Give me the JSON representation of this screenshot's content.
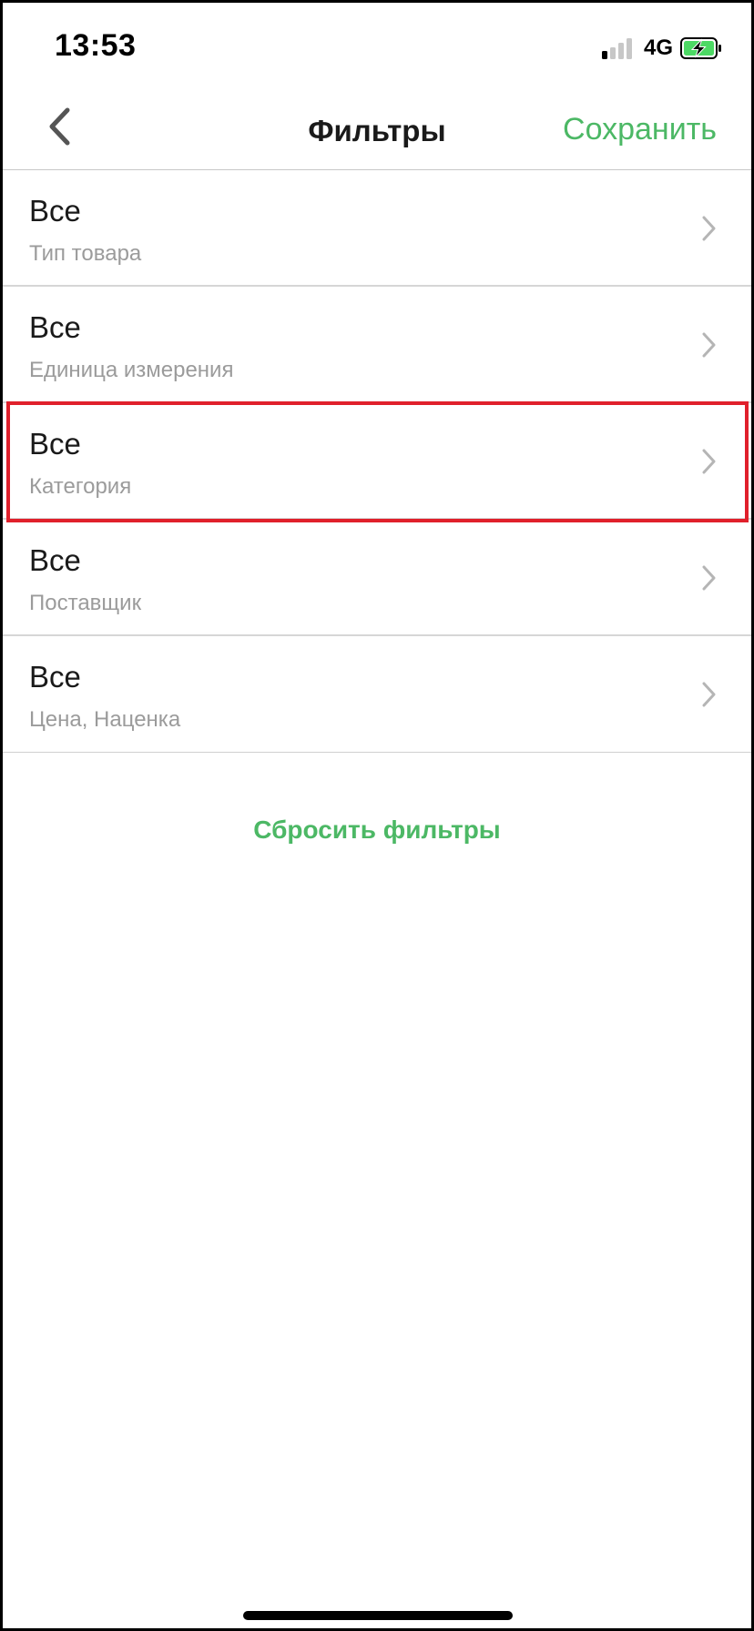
{
  "status_bar": {
    "time": "13:53",
    "network": "4G",
    "signal_bars_active": 1,
    "signal_bars_total": 4,
    "battery_state": "charging",
    "icons": [
      "signal-icon",
      "battery-charging-icon"
    ]
  },
  "nav": {
    "back_icon": "chevron-left-icon",
    "title": "Фильтры",
    "save_label": "Сохранить"
  },
  "filters": [
    {
      "value": "Все",
      "label": "Тип товара"
    },
    {
      "value": "Все",
      "label": "Единица измерения"
    },
    {
      "value": "Все",
      "label": "Категория"
    },
    {
      "value": "Все",
      "label": "Поставщик"
    },
    {
      "value": "Все",
      "label": "Цена, Наценка"
    }
  ],
  "highlighted_filter_index": 2,
  "reset_label": "Сбросить фильтры",
  "colors": {
    "accent": "#4cb865",
    "highlight_border": "#e0202b",
    "secondary_text": "#9b9b9b",
    "primary_text": "#1a1a1a"
  }
}
